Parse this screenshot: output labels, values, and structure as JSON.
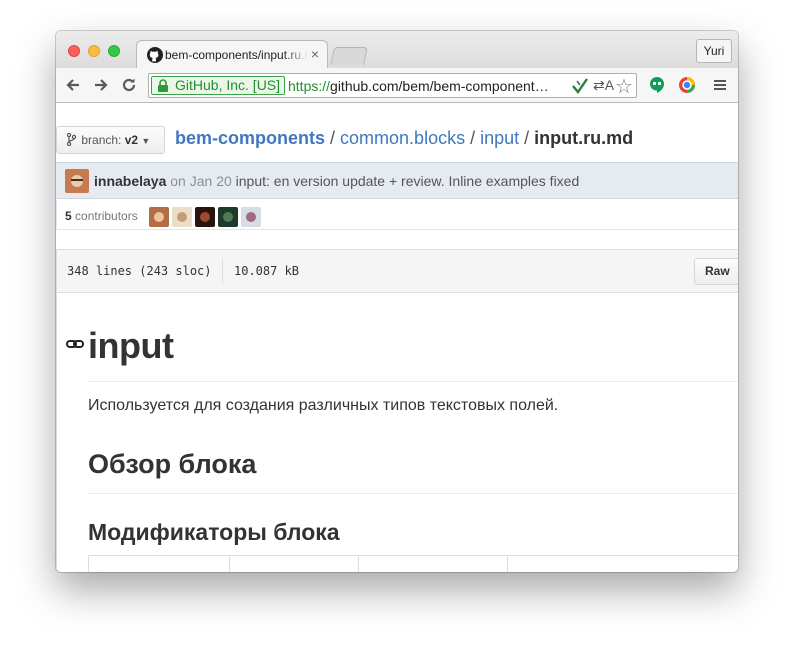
{
  "browser": {
    "tab_title": "bem-components/input.ru.md",
    "tab_close": "×",
    "profile_name": "Yuri",
    "ev_label": "GitHub, Inc. [US]",
    "url_scheme": "https://",
    "url_rest": "github.com/bem/bem-component…",
    "translate_glyph": "⇄A",
    "star_glyph": "☆"
  },
  "repo": {
    "branch_label": "branch:",
    "branch_name": "v2",
    "breadcrumb": {
      "repo": "bem-components",
      "sep1": " / ",
      "dir1": "common.blocks",
      "sep2": " / ",
      "dir2": "input",
      "sep3": " / ",
      "file": "input.ru.md"
    }
  },
  "commit": {
    "author": "innabelaya",
    "date": "on Jan 20",
    "message": "input: en version update + review. Inline examples fixed"
  },
  "contributors": {
    "count": "5",
    "label": "contributors"
  },
  "file": {
    "lines": "348 lines (243 sloc)",
    "size": "10.087 kB",
    "raw_label": "Raw"
  },
  "markdown": {
    "h1": "input",
    "intro": "Используется для создания различных типов текстовых полей.",
    "h2": "Обзор блока",
    "h3": "Модификаторы блока"
  },
  "colors": {
    "link": "#4078c0",
    "ev_green": "#218f2a",
    "commit_bar_bg": "#e6ebf1"
  }
}
